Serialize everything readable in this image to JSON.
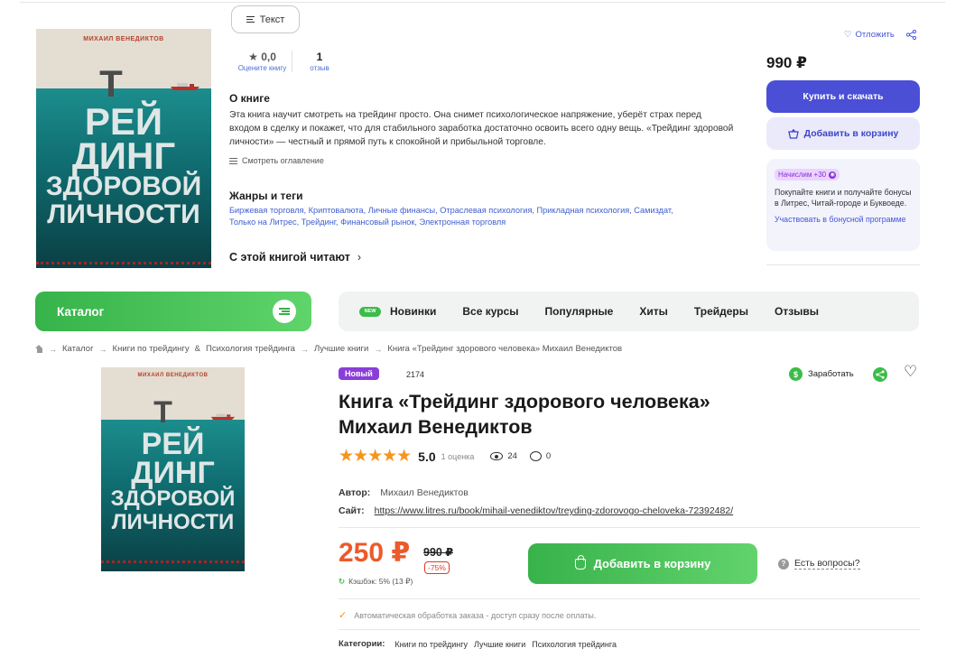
{
  "litres": {
    "text_button": "Текст",
    "cover": {
      "author": "МИХАИЛ ВЕНЕДИКТОВ",
      "line1": "Т",
      "line2": "РЕЙ",
      "line3": "ДИНГ",
      "line4": "ЗДОРОВОЙ",
      "line5": "ЛИЧНОСТИ"
    },
    "rating": {
      "value": "★ 0,0",
      "caption": "Оцените книгу"
    },
    "reviews": {
      "value": "1",
      "caption": "отзыв"
    },
    "about_heading": "О книге",
    "about_text": "Эта книга научит смотреть на трейдинг просто. Она снимет психологическое напряжение, уберёт страх перед входом в сделку и покажет, что для стабильного заработка достаточно освоить всего одну вещь. «Трейдинг здоровой личности» — честный и прямой путь к спокойной и прибыльной торговле.",
    "toc_link": "Смотреть оглавление",
    "genres_heading": "Жанры и теги",
    "tags": [
      "Биржевая торговля",
      "Криптовалюта",
      "Личные финансы",
      "Отраслевая психология",
      "Прикладная психология",
      "Самиздат",
      "Только на Литрес",
      "Трейдинг",
      "Финансовый рынок",
      "Электронная торговля"
    ],
    "read_with_heading": "С этой книгой читают",
    "defer_label": "Отложить",
    "price": "990 ₽",
    "buy_button": "Купить и скачать",
    "add_to_cart": "Добавить в корзину",
    "bonus": {
      "chip": "Начислим +30",
      "text": "Покупайте книги и получайте бонусы в Литрес, Читай-городе и Буквоеде.",
      "link": "Участвовать в бонусной программе"
    }
  },
  "shop": {
    "catalog_button": "Каталог",
    "nav": {
      "new_badge": "NEW",
      "items": [
        "Новинки",
        "Все курсы",
        "Популярные",
        "Хиты",
        "Трейдеры",
        "Отзывы"
      ]
    },
    "breadcrumb": [
      "Каталог",
      "Книги по трейдингу",
      "&",
      "Психология трейдинга",
      "Лучшие книги",
      "Книга «Трейдинг здорового человека» Михаил Венедиктов"
    ],
    "cover": {
      "author": "МИХАИЛ ВЕНЕДИКТОВ",
      "line1": "Т",
      "line2": "РЕЙ",
      "line3": "ДИНГ",
      "line4": "ЗДОРОВОЙ",
      "line5": "ЛИЧНОСТИ"
    },
    "badge_new": "Новый",
    "article_number": "2174",
    "earn_label": "Заработать",
    "title": "Книга «Трейдинг здорового человека» Михаил Венедиктов",
    "rating": {
      "stars": "★★★★★",
      "score": "5.0",
      "count": "1 оценка",
      "views": "24",
      "comments": "0"
    },
    "author_label": "Автор:",
    "author_value": "Михаил Венедиктов",
    "site_label": "Сайт:",
    "site_value": "https://www.litres.ru/book/mihail-venediktov/treyding-zdorovogo-cheloveka-72392482/",
    "price_now": "250 ₽",
    "price_old": "990 ₽",
    "discount": "-75%",
    "cashback": "Кэшбэк: 5% (13 ₽)",
    "add_to_cart": "Добавить в корзину",
    "questions": "Есть вопросы?",
    "auto_note": "Автоматическая обработка заказа - доступ сразу после оплаты.",
    "categories_label": "Категории:",
    "categories": [
      "Книги по трейдингу",
      "Лучшие книги",
      "Психология трейдинга"
    ]
  },
  "colors": {
    "litres_accent": "#4a4fd6",
    "shop_green": "#3cbc48",
    "price_orange": "#ec5a2b",
    "star_orange": "#f6951d",
    "badge_purple": "#8a3ed8"
  }
}
